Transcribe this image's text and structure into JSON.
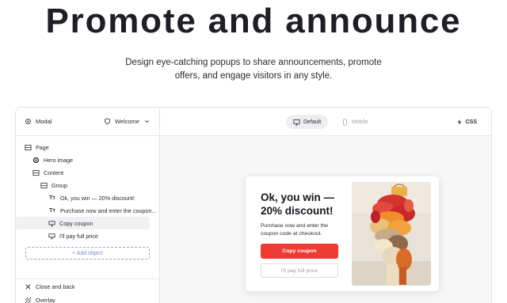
{
  "hero": {
    "title": "Promote and announce",
    "subtitle_line1": "Design eye-catching popups to share announcements, promote",
    "subtitle_line2": "offers, and engage visitors in any style."
  },
  "sidebar": {
    "modal_label": "Modal",
    "template_label": "Welcome",
    "tree": [
      {
        "label": "Page",
        "icon": "page-layout-icon"
      },
      {
        "label": "Hero image",
        "icon": "circle-dot-icon"
      },
      {
        "label": "Content",
        "icon": "layout-icon"
      },
      {
        "label": "Group",
        "icon": "group-icon"
      },
      {
        "label": "Ok, you win — 20% discount!",
        "icon": "text-icon"
      },
      {
        "label": "Purchase now and enter the coupon...",
        "icon": "text-icon"
      },
      {
        "label": "Copy coupon",
        "icon": "button-icon"
      },
      {
        "label": "I'll pay full price",
        "icon": "button-icon"
      }
    ],
    "add_object_label": "+ Add object",
    "footer": [
      {
        "label": "Close and back",
        "icon": "close-icon"
      },
      {
        "label": "Overlay",
        "icon": "overlay-icon"
      }
    ]
  },
  "toolbar": {
    "default_label": "Default",
    "mobile_label": "Mobile",
    "css_label": "CSS"
  },
  "popup": {
    "heading": "Ok, you win — 20% discount!",
    "body": "Purchase now and enter the coupon code at checkout.",
    "primary_label": "Copy coupon",
    "secondary_label": "I'll pay full price"
  },
  "colors": {
    "accent_red": "#ec3b35",
    "dashed_blue": "#8fa4d8"
  }
}
